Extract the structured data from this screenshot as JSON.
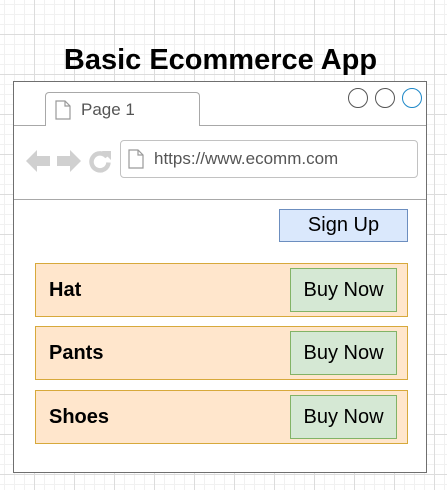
{
  "title": "Basic Ecommerce App",
  "browser": {
    "tab": {
      "label": "Page 1",
      "icon": "document-icon"
    },
    "window_controls": [
      "minimize-icon",
      "maximize-icon",
      "close-icon"
    ],
    "nav_icons": [
      "back-arrow-icon",
      "forward-arrow-icon",
      "reload-icon"
    ],
    "url": "https://www.ecomm.com"
  },
  "header": {
    "signup_label": "Sign Up"
  },
  "products": [
    {
      "name": "Hat",
      "button_label": "Buy Now"
    },
    {
      "name": "Pants",
      "button_label": "Buy Now"
    },
    {
      "name": "Shoes",
      "button_label": "Buy Now"
    }
  ],
  "colors": {
    "signup_fill": "#dae8fc",
    "signup_border": "#6c8ebf",
    "product_fill": "#ffe6cc",
    "product_border": "#d7a93b",
    "buy_fill": "#d5e8d4",
    "buy_border": "#82b366",
    "close_control_accent": "#1e88c8"
  }
}
